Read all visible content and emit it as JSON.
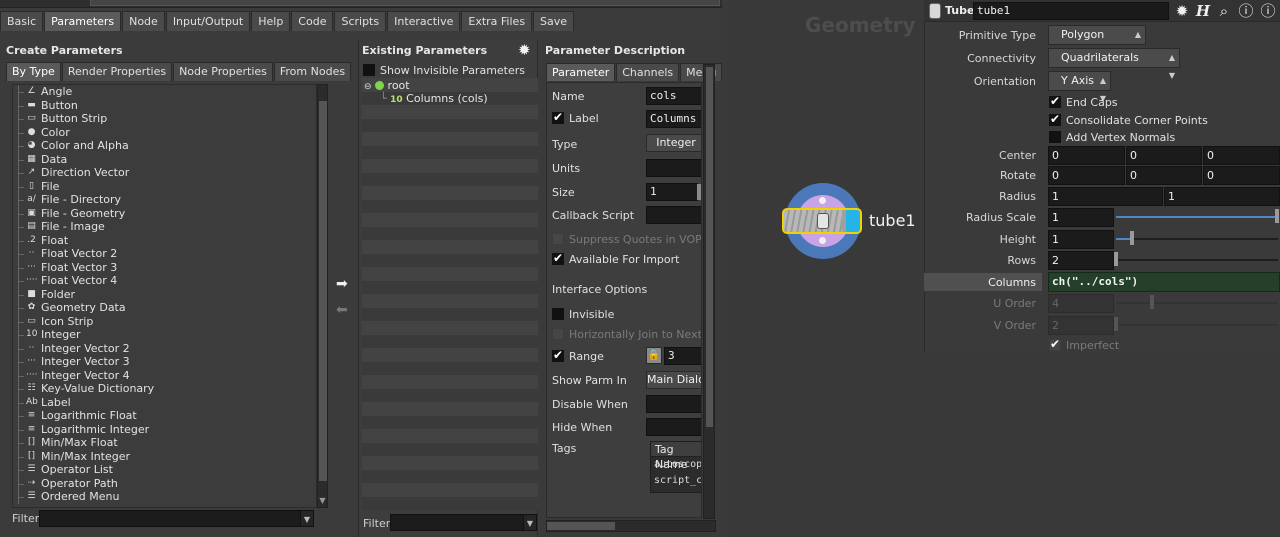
{
  "editor": {
    "main_tabs": [
      "Basic",
      "Parameters",
      "Node",
      "Input/Output",
      "Help",
      "Code",
      "Scripts",
      "Interactive",
      "Extra Files",
      "Save"
    ],
    "active_main_tab": "Parameters",
    "create": {
      "title": "Create Parameters",
      "tabs": [
        "By Type",
        "Render Properties",
        "Node Properties",
        "From Nodes"
      ],
      "items": [
        {
          "label": "Angle",
          "icon": "∠"
        },
        {
          "label": "Button",
          "icon": "▬"
        },
        {
          "label": "Button Strip",
          "icon": "▭"
        },
        {
          "label": "Color",
          "icon": "●"
        },
        {
          "label": "Color and Alpha",
          "icon": "◕"
        },
        {
          "label": "Data",
          "icon": "▦"
        },
        {
          "label": "Direction Vector",
          "icon": "↗"
        },
        {
          "label": "File",
          "icon": "▯"
        },
        {
          "label": "File - Directory",
          "icon": "a/"
        },
        {
          "label": "File - Geometry",
          "icon": "▣"
        },
        {
          "label": "File - Image",
          "icon": "▤"
        },
        {
          "label": "Float",
          "icon": ".2"
        },
        {
          "label": "Float Vector 2",
          "icon": "··"
        },
        {
          "label": "Float Vector 3",
          "icon": "···"
        },
        {
          "label": "Float Vector 4",
          "icon": "····"
        },
        {
          "label": "Folder",
          "icon": "■"
        },
        {
          "label": "Geometry Data",
          "icon": "✿"
        },
        {
          "label": "Icon Strip",
          "icon": "▭"
        },
        {
          "label": "Integer",
          "icon": "10"
        },
        {
          "label": "Integer Vector 2",
          "icon": "··"
        },
        {
          "label": "Integer Vector 3",
          "icon": "···"
        },
        {
          "label": "Integer Vector 4",
          "icon": "····"
        },
        {
          "label": "Key-Value Dictionary",
          "icon": "☷"
        },
        {
          "label": "Label",
          "icon": "Ab"
        },
        {
          "label": "Logarithmic Float",
          "icon": "≡"
        },
        {
          "label": "Logarithmic Integer",
          "icon": "≡"
        },
        {
          "label": "Min/Max Float",
          "icon": "[]"
        },
        {
          "label": "Min/Max Integer",
          "icon": "[]"
        },
        {
          "label": "Operator List",
          "icon": "☰"
        },
        {
          "label": "Operator Path",
          "icon": "⇢"
        },
        {
          "label": "Ordered Menu",
          "icon": "☰"
        }
      ],
      "filter_label": "Filter"
    },
    "existing": {
      "title": "Existing Parameters",
      "show_invisible_label": "Show Invisible Parameters",
      "root_label": "root",
      "column_label": "Columns (cols)",
      "column_icon": "10",
      "filter_label": "Filter"
    },
    "description": {
      "title": "Parameter Description",
      "tabs": [
        "Parameter",
        "Channels",
        "Menu"
      ],
      "name_label": "Name",
      "name_value": "cols",
      "label_label": "Label",
      "label_value": "Columns",
      "type_label": "Type",
      "type_value": "Integer",
      "units_label": "Units",
      "size_label": "Size",
      "size_value": "1",
      "callback_label": "Callback Script",
      "suppress_label": "Suppress Quotes in VOP Code",
      "available_label": "Available For Import",
      "interface_label": "Interface Options",
      "invisible_label": "Invisible",
      "hjoin_label": "Horizontally Join to Next Parameter",
      "range_label": "Range",
      "range_value": "3",
      "show_parm_label": "Show Parm In",
      "show_parm_value": "Main Dialog",
      "disable_label": "Disable When",
      "hide_label": "Hide When",
      "tags_label": "Tags",
      "tags_header": "Tag Name",
      "tags": [
        "autoscope",
        "script_callback"
      ]
    }
  },
  "network": {
    "context_label": "Geometry",
    "node_name": "tube1"
  },
  "params": {
    "node_type": "Tube",
    "node_name": "tube1",
    "primitive_type_label": "Primitive Type",
    "primitive_type_value": "Polygon",
    "connectivity_label": "Connectivity",
    "connectivity_value": "Quadrilaterals",
    "orientation_label": "Orientation",
    "orientation_value": "Y Axis",
    "end_caps_label": "End Caps",
    "consolidate_label": "Consolidate Corner Points",
    "vertex_normals_label": "Add Vertex Normals",
    "center_label": "Center",
    "center": [
      "0",
      "0",
      "0"
    ],
    "rotate_label": "Rotate",
    "rotate": [
      "0",
      "0",
      "0"
    ],
    "radius_label": "Radius",
    "radius": [
      "1",
      "1"
    ],
    "radius_scale_label": "Radius Scale",
    "radius_scale": "1",
    "height_label": "Height",
    "height": "1",
    "rows_label": "Rows",
    "rows": "2",
    "columns_label": "Columns",
    "columns_expr": "ch(\"../cols\")",
    "u_order_label": "U Order",
    "u_order": "4",
    "v_order_label": "V Order",
    "v_order": "2",
    "imperfect_label": "Imperfect"
  }
}
